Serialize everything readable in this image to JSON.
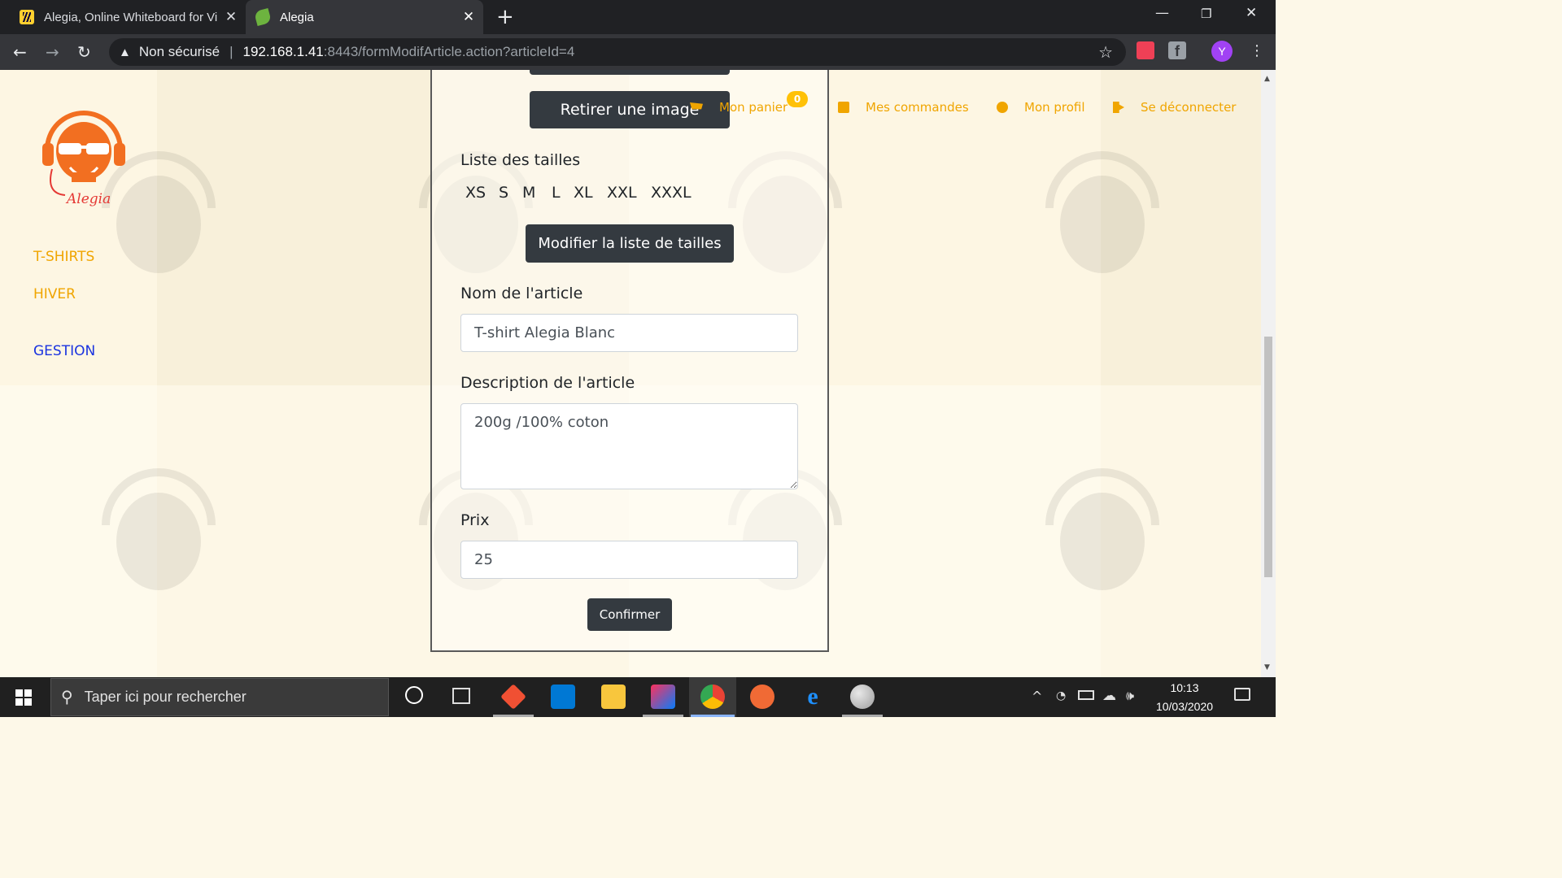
{
  "browser": {
    "tabs": [
      {
        "title": "Alegia, Online Whiteboard for Vi",
        "active": false,
        "icon": "miro-icon"
      },
      {
        "title": "Alegia",
        "active": true,
        "icon": "spring-leaf-icon"
      }
    ],
    "new_tab": "+",
    "address": {
      "security_label": "Non sécurisé",
      "separator": "|",
      "host": "192.168.1.41",
      "path": ":8443/formModifArticle.action?articleId=4"
    },
    "profile_initial": "Y",
    "ext_fb": "f"
  },
  "site": {
    "logo_text": "Alegia",
    "sidebar": {
      "tshirts": "T-SHIRTS",
      "hiver": "HIVER",
      "gestion": "GESTION"
    },
    "nav": {
      "cart": "Mon panier",
      "cart_count": "0",
      "orders": "Mes commandes",
      "profile": "Mon profil",
      "logout": "Se déconnecter"
    }
  },
  "form": {
    "remove_image_button": "Retirer une image",
    "sizes_heading": "Liste des tailles",
    "sizes": [
      "XS",
      "S",
      "M",
      "L",
      "XL",
      "XXL",
      "XXXL"
    ],
    "modify_sizes_button": "Modifier la liste de tailles",
    "name_label": "Nom de l'article",
    "name_value": "T-shirt Alegia Blanc",
    "description_label": "Description de l'article",
    "description_value": "200g /100% coton",
    "price_label": "Prix",
    "price_value": "25",
    "confirm_button": "Confirmer"
  },
  "taskbar": {
    "search_placeholder": "Taper ici pour rechercher",
    "time": "10:13",
    "date": "10/03/2020"
  },
  "colors": {
    "accent_orange": "#f0a500",
    "link_blue": "#1a33e0",
    "button_dark": "#343a40",
    "badge_yellow": "#ffc107"
  }
}
